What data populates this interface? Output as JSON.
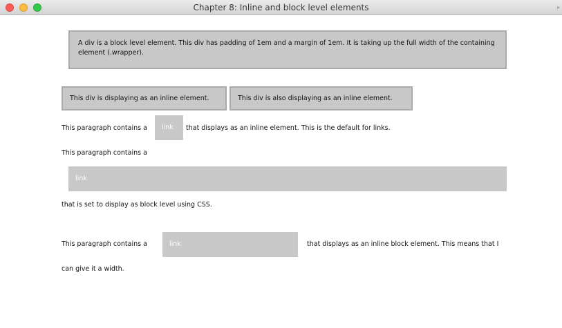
{
  "window": {
    "title": "Chapter 8: Inline and block level elements",
    "controls": [
      "close",
      "minimize",
      "zoom"
    ]
  },
  "content": {
    "block_div_text": "A div is a block level element. This div has padding of 1em and a margin of 1em. It is taking up the full width of the containing element (.wrapper).",
    "inline_div_1": "This div is displaying as an inline element.",
    "inline_div_2": "This div is also displaying as an inline element.",
    "para1": {
      "before": "This paragraph contains a",
      "link": "link",
      "after": "that displays as an inline element. This is the default for links."
    },
    "para2": {
      "before": "This paragraph contains a",
      "link": "link",
      "after": "that is set to display as block level using CSS."
    },
    "para3": {
      "before": "This paragraph contains a",
      "link": "link",
      "after": "that displays as an inline block element. This means that I",
      "wrap": "can give it a width."
    }
  },
  "colors": {
    "box_background": "#c8c8c8",
    "box_border": "#aaaaaa",
    "link_text": "#ffffff"
  }
}
